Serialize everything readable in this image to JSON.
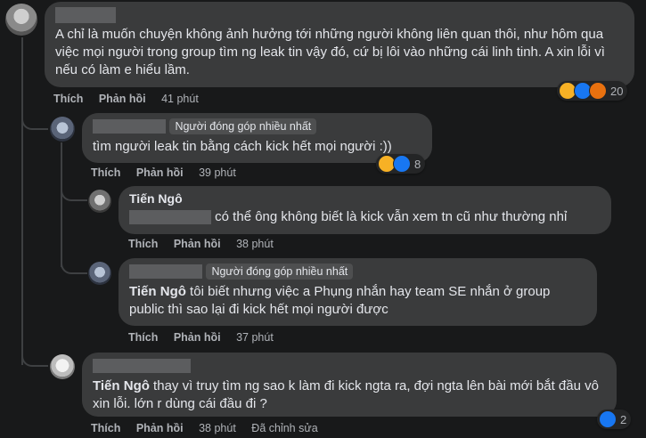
{
  "colors": {
    "background": "#18191a",
    "bubble": "#3a3b3c",
    "muted": "#b0b3b8",
    "like": "#1877f2",
    "haha": "#f7b125",
    "angry": "#e9710f"
  },
  "c1": {
    "text": "A chỉ là muốn chuyện không ảnh hưởng tới những người không liên quan thôi, như hôm qua việc mọi người trong group tìm ng leak tin vậy đó, cứ bị lôi vào những cái linh tinh. A xin lỗi vì nếu có làm e hiểu lầm.",
    "like": "Thích",
    "reply": "Phản hồi",
    "time": "41 phút",
    "reactions": [
      "haha-icon",
      "like-icon",
      "angry-icon"
    ],
    "reaction_count": "20"
  },
  "c2": {
    "badge": "Người đóng góp nhiều nhất",
    "text": "tìm người leak tin bằng cách kick hết mọi người :))",
    "like": "Thích",
    "reply": "Phản hồi",
    "time": "39 phút",
    "reactions": [
      "haha-icon",
      "like-icon"
    ],
    "reaction_count": "8"
  },
  "c3": {
    "name": "Tiến Ngô",
    "text": "có thể ông không biết là kick vẫn xem tn cũ như thường nhỉ",
    "like": "Thích",
    "reply": "Phản hồi",
    "time": "38 phút"
  },
  "c4": {
    "badge": "Người đóng góp nhiều nhất",
    "mention": "Tiến Ngô",
    "text": " tôi biết nhưng việc a Phụng nhắn hay team SE nhắn ở group public thì sao lại đi kick hết mọi người được",
    "like": "Thích",
    "reply": "Phản hồi",
    "time": "37 phút"
  },
  "c5": {
    "mention": "Tiến Ngô",
    "text": " thay vì truy tìm ng sao k làm đi kick ngta ra, đợi ngta lên bài mới bắt đầu vô xin lỗi. lớn r dùng cái đầu đi ?",
    "like": "Thích",
    "reply": "Phản hồi",
    "time": "38 phút",
    "edited": "Đã chỉnh sửa",
    "reactions": [
      "like-icon"
    ],
    "reaction_count": "2"
  }
}
